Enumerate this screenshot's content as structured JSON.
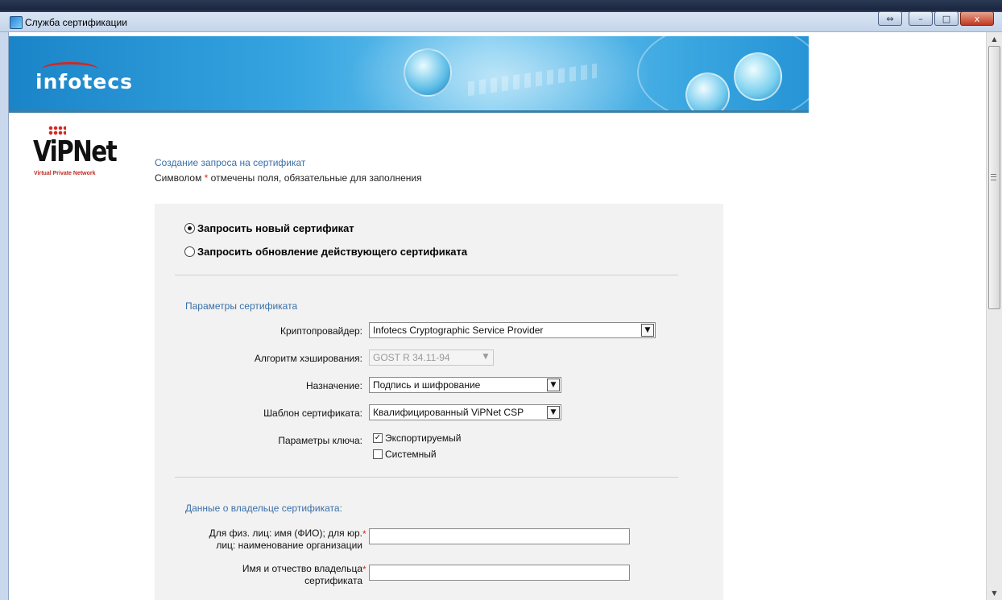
{
  "window": {
    "title": "Служба сертификации",
    "minimize_label": "–",
    "maximize_label": "□",
    "close_label": "x",
    "resize_label": "⇔"
  },
  "branding": {
    "company_logo_text": "infotecs",
    "product_logo_text": "ViPNet",
    "product_tagline": "Virtual Private Network"
  },
  "page": {
    "heading": "Создание запроса на сертификат",
    "required_note_prefix": "Символом ",
    "required_marker": "*",
    "required_note_suffix": " отмечены поля, обязательные для заполнения"
  },
  "request_type": {
    "options": [
      {
        "label": "Запросить новый сертификат",
        "selected": true
      },
      {
        "label": "Запросить обновление действующего сертификата",
        "selected": false
      }
    ]
  },
  "cert_params": {
    "section_title": "Параметры сертификата",
    "provider_label": "Криптопровайдер:",
    "provider_value": "Infotecs Cryptographic Service Provider",
    "hash_label": "Алгоритм хэширования:",
    "hash_value": "GOST R 34.11-94",
    "purpose_label": "Назначение:",
    "purpose_value": "Подпись и шифрование",
    "template_label": "Шаблон сертификата:",
    "template_value": "Квалифицированный ViPNet CSP",
    "key_params_label": "Параметры ключа:",
    "key_options": [
      {
        "label": "Экспортируемый",
        "checked": true
      },
      {
        "label": "Системный",
        "checked": false
      }
    ]
  },
  "owner": {
    "section_title": "Данные о владельце сертификата:",
    "name_label_line1": "Для физ. лиц: имя (ФИО); для юр.",
    "name_label_line2": "лиц: наименование организации",
    "name_value": "",
    "patronymic_label_line1": "Имя и отчество владельца",
    "patronymic_label_line2": "сертификата",
    "patronymic_value": ""
  },
  "icons": {
    "dropdown": "▼",
    "check": "✓",
    "scroll_up": "▲",
    "scroll_down": "▼"
  },
  "colors": {
    "link_blue": "#3a6fa8",
    "required_red": "#d22a20",
    "panel_bg": "#f2f2f2"
  }
}
